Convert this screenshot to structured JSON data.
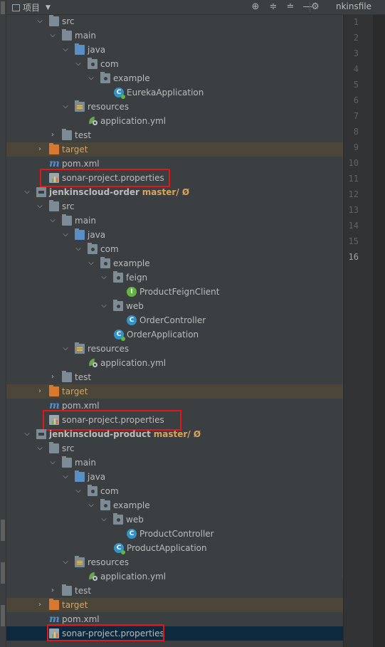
{
  "header": {
    "title": "项目",
    "dropdown_icon": "▼",
    "toolbar": [
      {
        "name": "locate-icon",
        "glyph": "⊕"
      },
      {
        "name": "expand-all-icon",
        "glyph": "≑"
      },
      {
        "name": "collapse-all-icon",
        "glyph": "≐"
      },
      {
        "name": "hide-icon",
        "glyph": "—"
      },
      {
        "name": "gear-icon",
        "glyph": "⚙"
      }
    ],
    "editor_tab": "nkinsfile"
  },
  "tree": {
    "r0": "src",
    "r1": "main",
    "r2": "java",
    "r3": "com",
    "r4": "example",
    "r5": "EurekaApplication",
    "r6": "resources",
    "r7": "application.yml",
    "r8": "test",
    "r9": "target",
    "r10": "pom.xml",
    "r11": "sonar-project.properties",
    "r12": {
      "module": "jenkinscloud-order",
      "branch": "master/ Ø"
    },
    "r13": "src",
    "r14": "main",
    "r15": "java",
    "r16": "com",
    "r17": "example",
    "r18": "feign",
    "r19": "ProductFeignClient",
    "r20": "web",
    "r21": "OrderController",
    "r22": "OrderApplication",
    "r23": "resources",
    "r24": "application.yml",
    "r25": "test",
    "r26": "target",
    "r27": "pom.xml",
    "r28": "sonar-project.properties",
    "r29": {
      "module": "jenkinscloud-product",
      "branch": "master/ Ø"
    },
    "r30": "src",
    "r31": "main",
    "r32": "java",
    "r33": "com",
    "r34": "example",
    "r35": "web",
    "r36": "ProductController",
    "r37": "ProductApplication",
    "r38": "resources",
    "r39": "application.yml",
    "r40": "test",
    "r41": "target",
    "r42": "pom.xml",
    "r43": "sonar-project.properties"
  },
  "editor": {
    "line_numbers": [
      "1",
      "2",
      "3",
      "4",
      "5",
      "6",
      "7",
      "8",
      "9",
      "10",
      "11",
      "12",
      "13",
      "14",
      "15",
      "16"
    ],
    "current_line": "16"
  },
  "colors": {
    "background": "#3c3f41",
    "target_row": "#4b4637",
    "selected_row": "#0d293e",
    "highlight_box": "#e01818",
    "excluded_text": "#d6a55c"
  }
}
